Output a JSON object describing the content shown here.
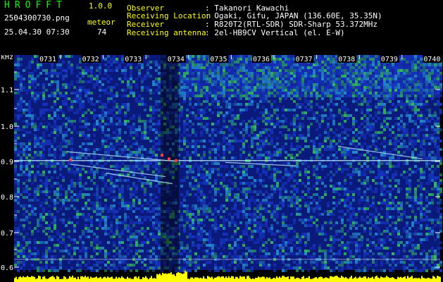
{
  "header": {
    "app_name": "HROFFT",
    "app_version": "1.0.0",
    "file_name": "2504300730.png",
    "date": "25.04.30",
    "time": "07:30",
    "meteor_label": "meteor",
    "meteor_count": "74"
  },
  "info": [
    {
      "key": "Observer",
      "value": ": Takanori Kawachi"
    },
    {
      "key": "Receiving Location",
      "value": ": Ogaki, Gifu, JAPAN (136.60E, 35.35N)"
    },
    {
      "key": "Receiver",
      "value": ": R820T2(RTL-SDR) SDR-Sharp 53.372MHz"
    },
    {
      "key": "Receiving antenna",
      "value": ": 2el-HB9CV Vertical (el. E-W)"
    }
  ],
  "spectrogram": {
    "unit": "kHz",
    "freq_ticks": [
      "1.1",
      "1.0",
      "0.9",
      "0.8",
      "0.7",
      "0.6"
    ],
    "freq_ticks_minor": [
      "1.15",
      "1.05",
      "0.95",
      "0.85",
      "0.75",
      "0.65"
    ],
    "time_labels": [
      "0731",
      "0732",
      "0733",
      "0734",
      "0735",
      "0736",
      "0737",
      "0738",
      "0739",
      "0740"
    ],
    "colors": {
      "background": "#0a1a7a",
      "noise_low": "#1a3ad0",
      "noise_mid": "#2a9ad8",
      "noise_high": "#3ad060",
      "carrier": "#bff0ff",
      "meteor": "#ff4040",
      "amplitude": "#ffff00"
    }
  }
}
